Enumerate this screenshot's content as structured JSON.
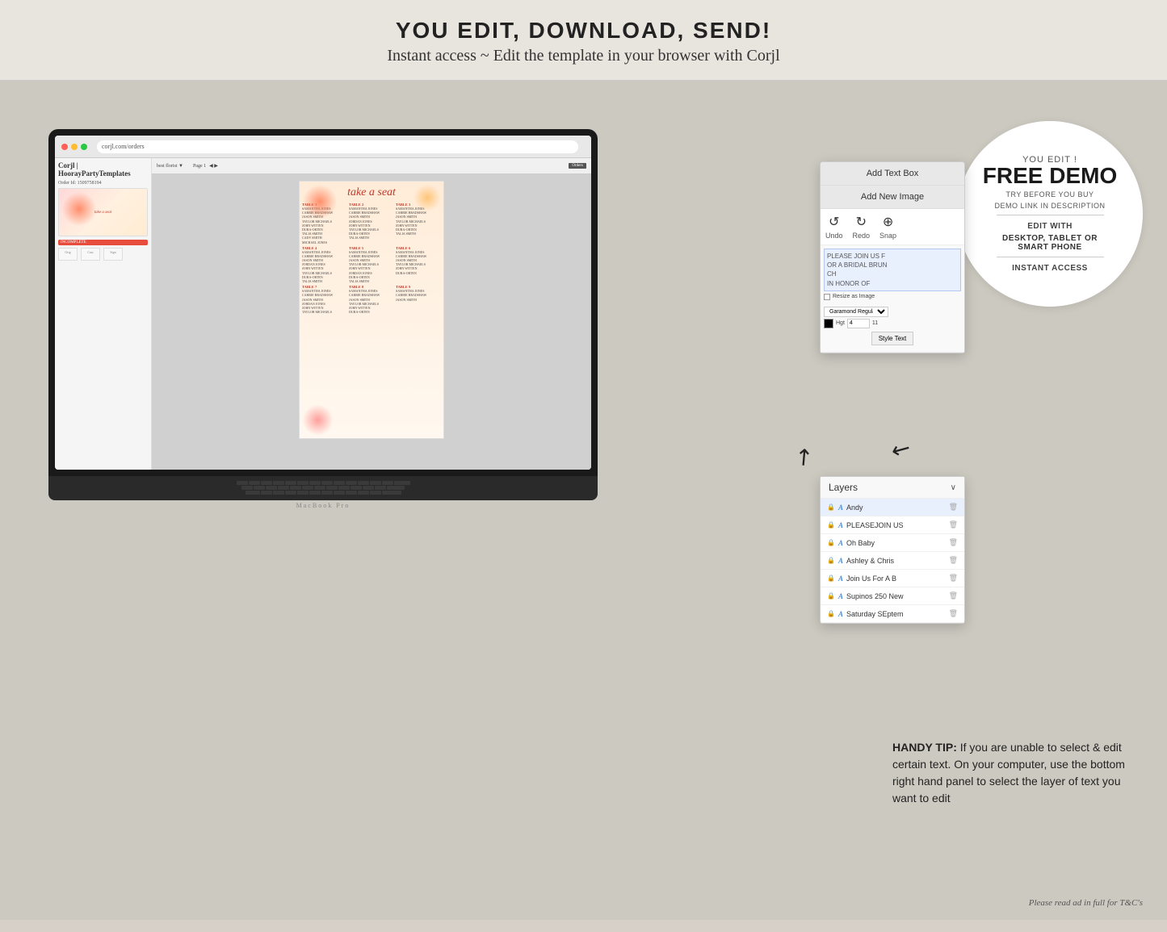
{
  "top_banner": {
    "heading": "YOU EDIT, DOWNLOAD, SEND!",
    "subheading": "Instant access ~ Edit the template in your browser with Corjl"
  },
  "laptop": {
    "browser_address": "corjl.com/orders",
    "order_id": "Order Id: 1509758194",
    "status": "INCOMPLETE"
  },
  "floating_panel": {
    "btn_add_text_box": "Add Text Box",
    "btn_add_new_image": "Add New Image",
    "btn_undo": "Undo",
    "btn_redo": "Redo",
    "btn_snap": "Snap",
    "preview_text_line1": "PLEASE JOIN US F",
    "preview_text_line2": "OR A BRIDAL BRUN",
    "preview_text_line3": "CH",
    "preview_text_line4": "IN HONOR OF",
    "checkbox_label": "Resize as Image",
    "dropdown_label": "Garamond Regular",
    "height_label": "Hgt",
    "height_value": "4",
    "width_value": "11",
    "style_text_btn": "Style Text"
  },
  "layers_panel": {
    "title": "Layers",
    "chevron": "∨",
    "items": [
      {
        "name": "Andy",
        "locked": true,
        "active": true
      },
      {
        "name": "PLEASEJOIN US",
        "locked": true,
        "active": false
      },
      {
        "name": "Oh Baby",
        "locked": true,
        "active": false
      },
      {
        "name": "Ashley & Chris",
        "locked": true,
        "active": false
      },
      {
        "name": "Join Us For A B",
        "locked": true,
        "active": false
      },
      {
        "name": "Supinos 250 New",
        "locked": true,
        "active": false
      },
      {
        "name": "Saturday SEptem",
        "locked": true,
        "active": false
      }
    ]
  },
  "free_demo": {
    "you_edit": "YOU EDIT !",
    "title": "FREE DEMO",
    "try_before": "TRY BEFORE YOU BUY",
    "demo_link": "DEMO LINK IN DESCRIPTION",
    "edit_with": "EDIT WITH",
    "platforms": "DESKTOP, TABLET OR\nSMART PHONE",
    "instant_access": "INSTANT ACCESS"
  },
  "handy_tip": {
    "label": "HANDY TIP:",
    "text": "If you are unable to select & edit certain text. On your computer, use the bottom right hand panel to select the layer of text you want to edit"
  },
  "terms": "Please read ad in full for T&C's",
  "seating_chart": {
    "title": "take a seat",
    "tables": [
      {
        "header": "TABLE 1",
        "names": [
          "SAMANTHA JONES",
          "CARRIE BRADSHAW",
          "JASON SMITH",
          "TAYLOR MICHAELS",
          "JOHN WITTEN",
          "DURA-ORTEN",
          "TALIA SMITH",
          "CADV SMITH",
          "MICHAEL JONES"
        ]
      },
      {
        "header": "TABLE 2",
        "names": [
          "SAMANTHA JONES",
          "CARRIE BRADSHAW",
          "JASON SMITH",
          "JORDAN JONES",
          "JOHN WITTEN",
          "TAYLOR MICHAELS",
          "DURA-ORTEN"
        ]
      },
      {
        "header": "TABLE 3",
        "names": [
          "SAMANTHA JONES",
          "CARRIE BRADSHAW",
          "JASON SMITH",
          "TAYLOR MICHAELS",
          "JOHN WITTEN",
          "DURA-ORTEN",
          "TALIA SMITH"
        ]
      }
    ]
  }
}
